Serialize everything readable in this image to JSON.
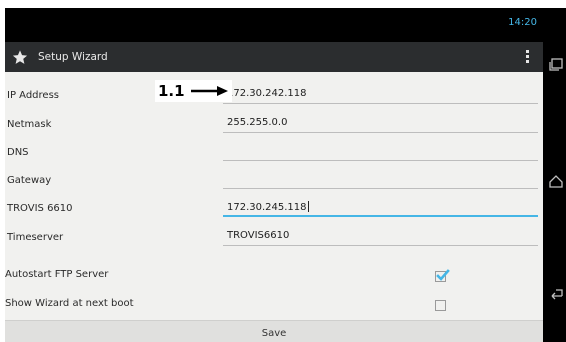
{
  "status_bar": {
    "time": "14:20"
  },
  "action_bar": {
    "title": "Setup Wizard",
    "icon": "star-icon",
    "menu_icon": "overflow-menu-icon"
  },
  "form": {
    "fields": [
      {
        "label": "IP Address",
        "value": "172.30.242.118"
      },
      {
        "label": "Netmask",
        "value": "255.255.0.0"
      },
      {
        "label": "DNS",
        "value": ""
      },
      {
        "label": "Gateway",
        "value": ""
      },
      {
        "label": "TROVIS 6610",
        "value": "172.30.245.118",
        "focused": true
      },
      {
        "label": "Timeserver",
        "value": "TROVIS6610"
      }
    ],
    "checkboxes": [
      {
        "label": "Autostart FTP Server",
        "checked": true
      },
      {
        "label": "Show Wizard at next boot",
        "checked": false
      }
    ],
    "save_label": "Save"
  },
  "annotation": {
    "label": "1.1",
    "arrow": "arrow-right-icon"
  },
  "nav_bar": {
    "buttons": [
      "recent-apps-icon",
      "home-icon",
      "back-icon"
    ]
  },
  "colors": {
    "accent": "#45b6e6",
    "action_bar": "#2b2d2f",
    "background": "#f1f1ef"
  }
}
